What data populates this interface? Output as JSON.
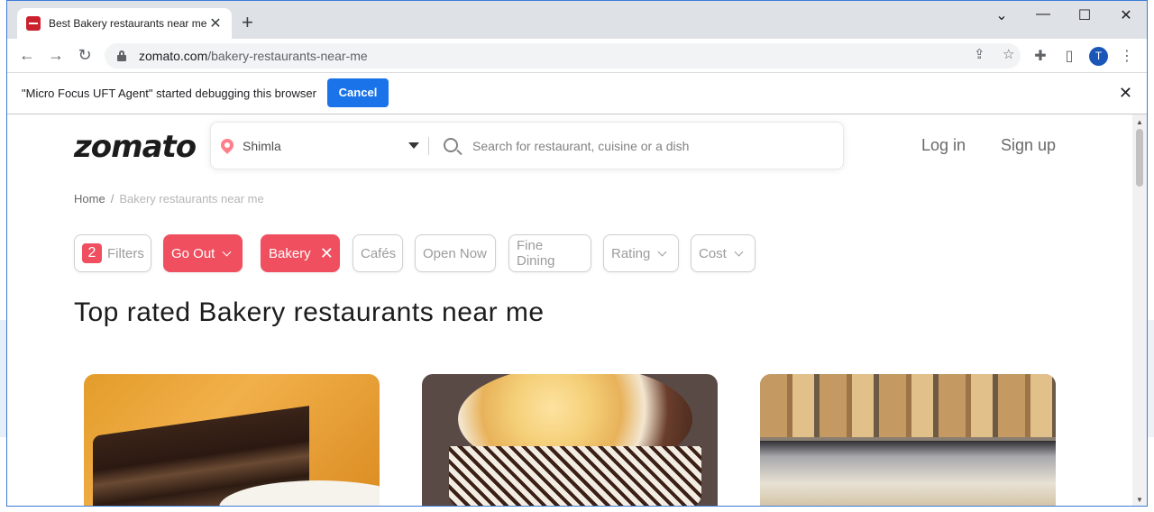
{
  "browser": {
    "tab_title": "Best Bakery restaurants near me",
    "url_host": "zomato.com",
    "url_path": "/bakery-restaurants-near-me",
    "avatar_letter": "T",
    "infobar_message": "\"Micro Focus UFT Agent\" started debugging this browser",
    "infobar_cancel": "Cancel"
  },
  "header": {
    "logo": "zomato",
    "location": "Shimla",
    "search_placeholder": "Search for restaurant, cuisine or a dish",
    "login": "Log in",
    "signup": "Sign up"
  },
  "breadcrumb": {
    "home": "Home",
    "separator": "/",
    "current": "Bakery restaurants near me"
  },
  "filters": {
    "count": "2",
    "filters_label": "Filters",
    "go_out": "Go Out",
    "bakery": "Bakery",
    "cafes": "Cafés",
    "open_now": "Open Now",
    "fine_dining": "Fine Dining",
    "rating": "Rating",
    "cost": "Cost"
  },
  "main": {
    "heading": "Top rated Bakery restaurants near me"
  },
  "colors": {
    "brand_red": "#ef4f5f",
    "chrome_blue": "#1a73e8"
  }
}
